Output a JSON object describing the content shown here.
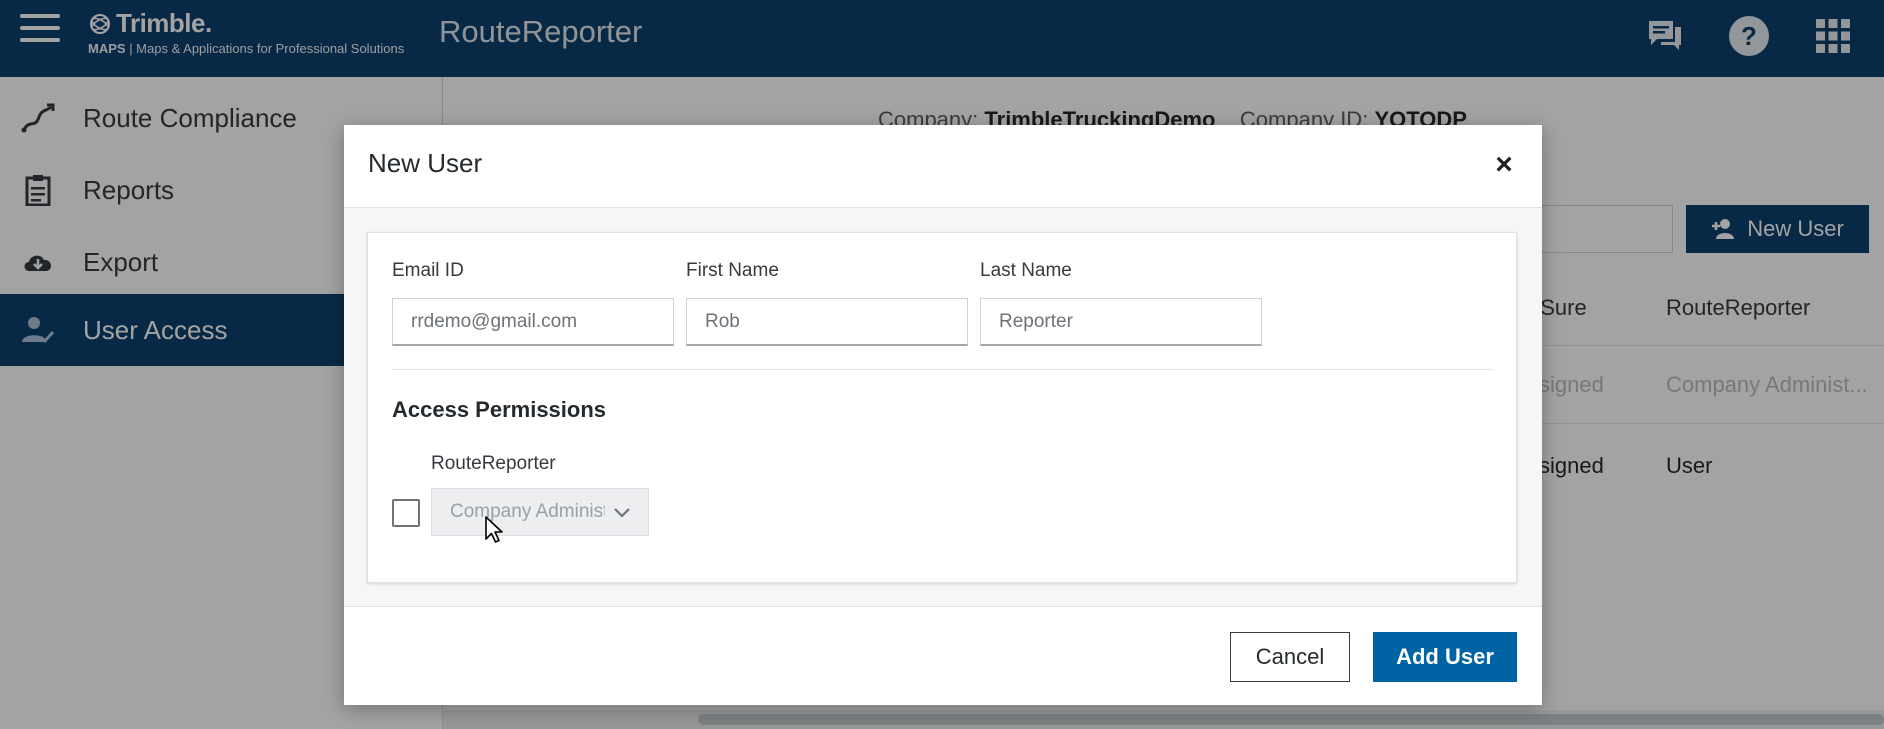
{
  "header": {
    "logo_brand": "Trimble.",
    "logo_maps": "MAPS",
    "logo_tagline": "| Maps & Applications for Professional Solutions",
    "app_title": "RouteReporter",
    "icons": [
      "chat-icon",
      "help-icon",
      "apps-grid-icon"
    ]
  },
  "sidebar": {
    "items": [
      {
        "label": "Route Compliance",
        "icon": "route-icon",
        "active": false
      },
      {
        "label": "Reports",
        "icon": "clipboard-icon",
        "active": false
      },
      {
        "label": "Export",
        "icon": "cloud-download-icon",
        "active": false
      },
      {
        "label": "User Access",
        "icon": "user-check-icon",
        "active": true
      }
    ]
  },
  "main": {
    "company_label": "Company:",
    "company_name": "TrimbleTruckingDemo",
    "company_id_label": "Company ID:",
    "company_id": "YOTODP",
    "new_user_button": "New User",
    "columns": [
      "pSure",
      "RouteReporter"
    ],
    "rows": [
      [
        "ssigned",
        "Company Administ..."
      ],
      [
        "ssigned",
        "User"
      ]
    ]
  },
  "modal": {
    "title": "New User",
    "close_glyph": "×",
    "fields": {
      "email": {
        "label": "Email ID",
        "value": "rrdemo@gmail.com"
      },
      "first_name": {
        "label": "First Name",
        "value": "Rob"
      },
      "last_name": {
        "label": "Last Name",
        "value": "Reporter"
      }
    },
    "permissions_title": "Access Permissions",
    "app_name": "RouteReporter",
    "role_select_value": "Company Administrator",
    "role_checked": false,
    "cancel_label": "Cancel",
    "add_label": "Add User"
  },
  "colors": {
    "header_bg": "#0e416c",
    "primary_button": "#0063a3"
  }
}
